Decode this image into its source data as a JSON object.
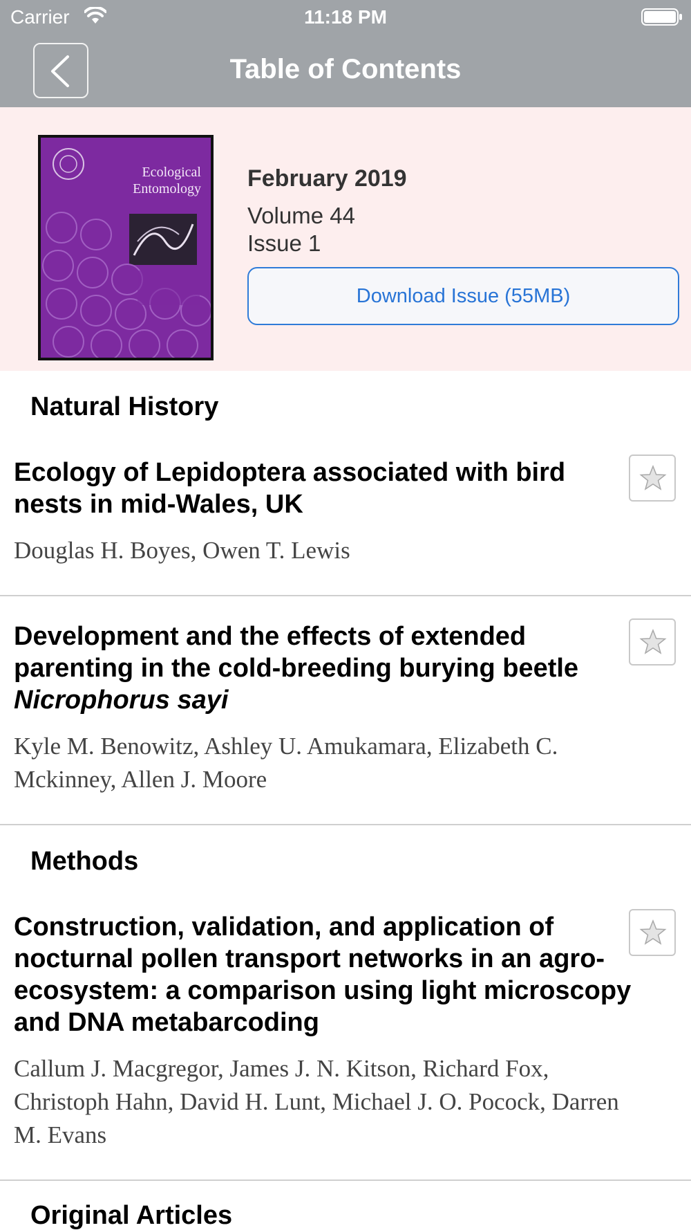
{
  "status_bar": {
    "carrier": "Carrier",
    "time": "11:18 PM"
  },
  "nav": {
    "title": "Table of Contents"
  },
  "issue": {
    "cover_title_line1": "Ecological",
    "cover_title_line2": "Entomology",
    "date": "February 2019",
    "volume": "Volume 44",
    "issue": "Issue 1",
    "download_label": "Download Issue (55MB)"
  },
  "sections": [
    {
      "title": "Natural History",
      "articles": [
        {
          "title": "Ecology of Lepidoptera associated with bird nests in mid-Wales, UK",
          "authors": "Douglas H. Boyes, Owen T. Lewis"
        },
        {
          "title_main": "Development and the effects of extended parenting in the cold-breeding burying beetle ",
          "title_species": "Nicrophorus sayi",
          "authors": "Kyle M. Benowitz, Ashley U. Amukamara, Elizabeth C. Mckinney, Allen J. Moore"
        }
      ]
    },
    {
      "title": "Methods",
      "articles": [
        {
          "title": "Construction, validation, and application of nocturnal pollen transport networks in an agro-ecosystem: a comparison using light microscopy and DNA metabarcoding",
          "authors": "Callum J. Macgregor, James J. N. Kitson, Richard Fox, Christoph Hahn, David H. Lunt, Michael J. O. Pocock, Darren M. Evans"
        }
      ]
    },
    {
      "title": "Original Articles"
    }
  ],
  "icons": {
    "back": "chevron-left-icon",
    "bookmark": "star-icon",
    "wifi": "wifi-icon",
    "battery": "battery-icon"
  },
  "colors": {
    "nav_bar": "#a0a4a8",
    "header_bg": "#fdeeee",
    "accent": "#2874d6",
    "cover": "#7d2aa0"
  }
}
